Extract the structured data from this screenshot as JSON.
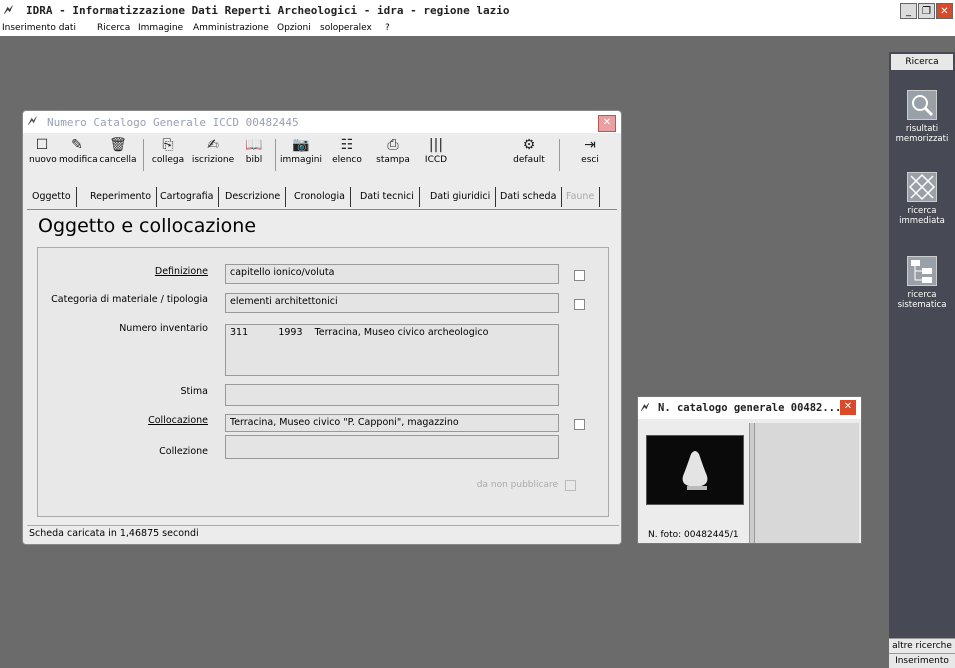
{
  "app": {
    "title": "IDRA - Informatizzazione Dati Reperti Archeologici - idra - regione lazio",
    "logo": "🗲"
  },
  "menu": [
    "Inserimento dati",
    "Ricerca",
    "Immagine",
    "Amministrazione",
    "Opzioni",
    "soloperalex",
    "?"
  ],
  "right_panel": {
    "header": "Ricerca",
    "tools": [
      {
        "label": "risultati memorizzati",
        "icon": "magnifier-icon"
      },
      {
        "label": "ricerca immediata",
        "icon": "grid-icon"
      },
      {
        "label": "ricerca sistematica",
        "icon": "tree-icon"
      }
    ],
    "bottom": [
      "altre ricerche",
      "Inserimento"
    ]
  },
  "main_window": {
    "title": "Numero Catalogo Generale ICCD 00482445",
    "toolbar": [
      {
        "label": "nuovo",
        "icon": "new-icon"
      },
      {
        "label": "modifica",
        "icon": "edit-icon"
      },
      {
        "label": "cancella",
        "icon": "delete-icon"
      },
      {
        "label": "collega",
        "icon": "link-icon"
      },
      {
        "label": "iscrizione",
        "icon": "inscription-icon"
      },
      {
        "label": "bibl",
        "icon": "book-icon"
      },
      {
        "label": "immagini",
        "icon": "camera-icon"
      },
      {
        "label": "elenco",
        "icon": "list-icon"
      },
      {
        "label": "stampa",
        "icon": "print-icon"
      },
      {
        "label": "ICCD",
        "icon": "barcode-icon"
      },
      {
        "label": "default",
        "icon": "default-icon"
      },
      {
        "label": "esci",
        "icon": "exit-icon"
      }
    ],
    "tabs": [
      "Oggetto",
      "Reperimento",
      "Cartografia",
      "Descrizione",
      "Cronologia",
      "Dati tecnici",
      "Dati giuridici",
      "Dati scheda",
      "Faune"
    ],
    "section_title": "Oggetto e collocazione",
    "fields": {
      "definizione": {
        "label": "Definizione",
        "value": "capitello ionico/voluta"
      },
      "categoria": {
        "label": "Categoria di materiale / tipologia",
        "value": "elementi architettonici"
      },
      "inventario": {
        "label": "Numero inventario",
        "value": "311          1993    Terracina, Museo civico archeologico"
      },
      "stima": {
        "label": "Stima",
        "value": ""
      },
      "collocazione": {
        "label": "Collocazione",
        "value": "Terracina, Museo civico \"P. Capponi\", magazzino"
      },
      "collezione": {
        "label": "Collezione",
        "value": ""
      }
    },
    "non_pubblicare": "da non pubblicare",
    "status": "Scheda caricata in 1,46875 secondi"
  },
  "photo_window": {
    "title": "N. catalogo generale 00482...",
    "caption": "N. foto: 00482445/1"
  }
}
